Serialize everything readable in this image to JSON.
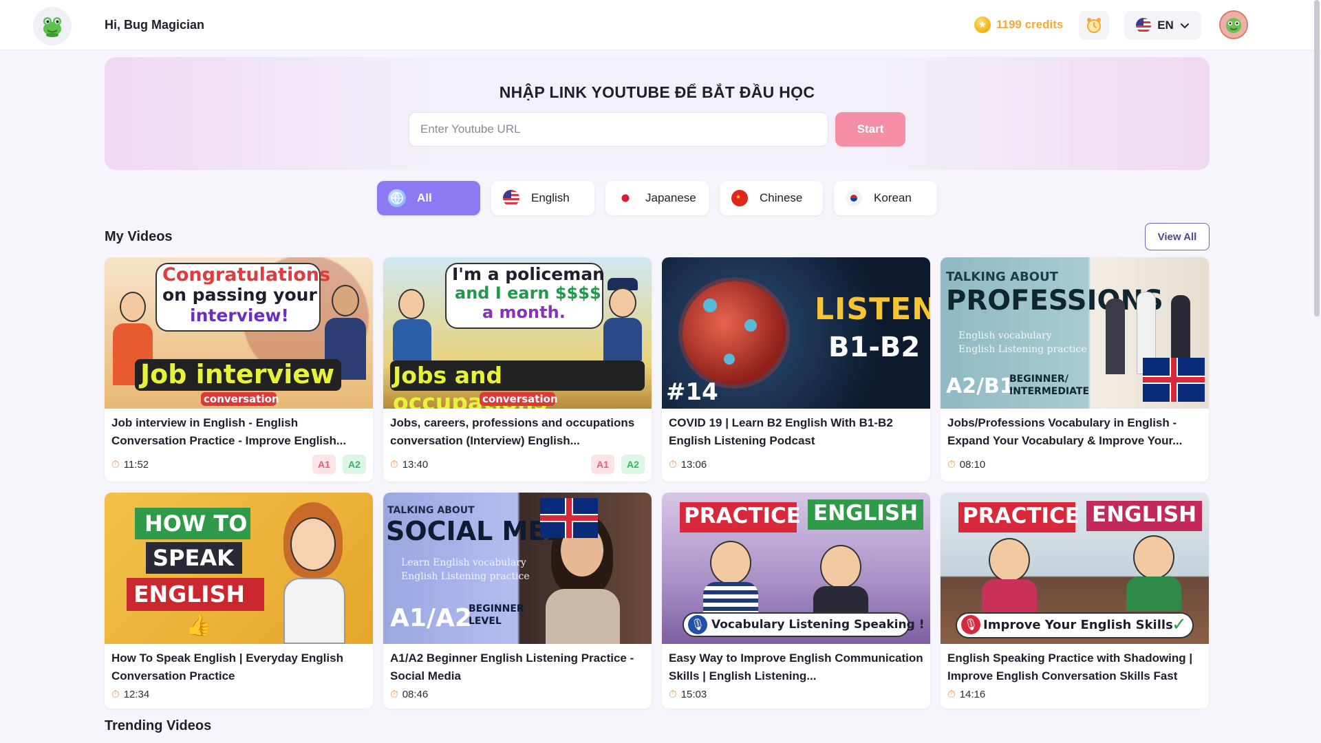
{
  "header": {
    "greeting": "Hi, Bug Magician",
    "credits": "1199 credits",
    "language": "EN"
  },
  "hero": {
    "title": "NHẬP LINK YOUTUBE ĐỂ BẮT ĐẦU HỌC",
    "url_placeholder": "Enter Youtube URL",
    "start_label": "Start"
  },
  "filters": [
    {
      "label": "All",
      "icon": "globe-icon",
      "active": true
    },
    {
      "label": "English",
      "icon": "us-flag-icon",
      "active": false
    },
    {
      "label": "Japanese",
      "icon": "japan-flag-icon",
      "active": false
    },
    {
      "label": "Chinese",
      "icon": "china-flag-icon",
      "active": false
    },
    {
      "label": "Korean",
      "icon": "korea-flag-icon",
      "active": false
    }
  ],
  "my_videos": {
    "title": "My Videos",
    "view_all": "View All",
    "items": [
      {
        "title": "Job interview in English - English Conversation Practice - Improve English...",
        "duration": "11:52",
        "levels": [
          "A1",
          "A2"
        ],
        "thumb": {
          "line1": "Congratulations",
          "line2": "on passing your",
          "line3": "interview!",
          "banner": "Job interview",
          "sub": "conversation"
        }
      },
      {
        "title": "Jobs, careers, professions and occupations conversation (Interview) English...",
        "duration": "13:40",
        "levels": [
          "A1",
          "A2"
        ],
        "thumb": {
          "line1": "I'm a policeman",
          "line2": "and I earn $$$$",
          "line3": "a month.",
          "banner": "Jobs and occupations",
          "sub": "conversation"
        }
      },
      {
        "title": "COVID 19 | Learn B2 English With B1-B2 English Listening Podcast",
        "duration": "13:06",
        "levels": [],
        "thumb": {
          "line1": "LISTEN",
          "line2": "B1-B2",
          "line3": "#14"
        }
      },
      {
        "title": "Jobs/Professions Vocabulary in English - Expand Your Vocabulary & Improve Your...",
        "duration": "08:10",
        "levels": [],
        "thumb": {
          "line1": "TALKING ABOUT",
          "line2": "PROFESSIONS",
          "line3": "English vocabulary",
          "line4": "English Listening practice",
          "level": "A2/B1",
          "level_sub": "BEGINNER/ INTERMEDIATE"
        }
      },
      {
        "title": "How To Speak English | Everyday English Conversation Practice",
        "duration": "12:34",
        "levels": [],
        "thumb": {
          "line1": "HOW TO",
          "line2": "SPEAK",
          "line3": "ENGLISH"
        }
      },
      {
        "title": "A1/A2 Beginner English Listening Practice - Social Media",
        "duration": "08:46",
        "levels": [],
        "thumb": {
          "line1": "TALKING ABOUT",
          "line2": "SOCIAL MEDIA",
          "line3": "Learn English vocabulary",
          "line4": "English Listening practice",
          "level": "A1/A2",
          "level_sub": "BEGINNER LEVEL"
        }
      },
      {
        "title": "Easy Way to Improve English Communication Skills | English Listening...",
        "duration": "15:03",
        "levels": [],
        "thumb": {
          "line1": "PRACTICE",
          "line2": "ENGLISH",
          "line3": "Vocabulary Listening Speaking !"
        }
      },
      {
        "title": "English Speaking Practice with Shadowing | Improve English Conversation Skills Fast",
        "duration": "14:16",
        "levels": [],
        "thumb": {
          "line1": "PRACTICE",
          "line2": "ENGLISH",
          "line3": "Improve Your English Skills"
        }
      }
    ]
  },
  "trending": {
    "title": "Trending Videos"
  },
  "colors": {
    "accent": "#8b7af3",
    "start_button": "#f58ea7",
    "credits": "#f2a93b",
    "a1_badge": "#e0607a",
    "a2_badge": "#3bb26a"
  }
}
